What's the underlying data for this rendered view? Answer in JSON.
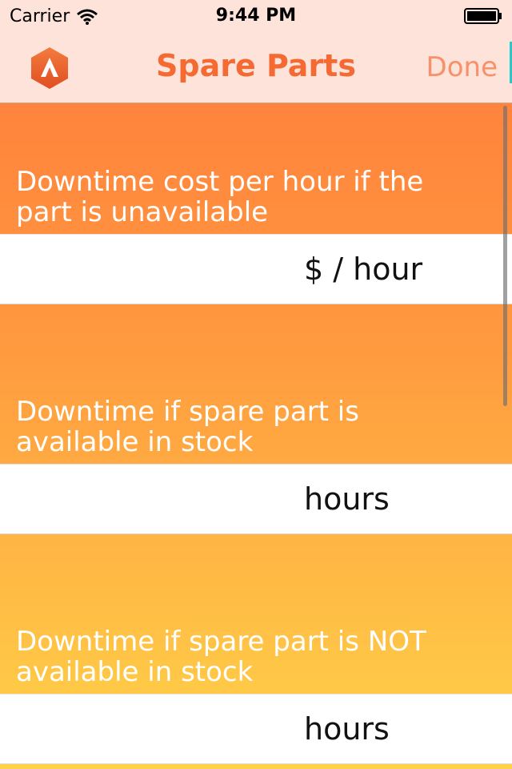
{
  "status": {
    "carrier": "Carrier",
    "time": "9:44 PM"
  },
  "nav": {
    "title": "Spare Parts",
    "done": "Done"
  },
  "fields": [
    {
      "label": "Downtime cost per hour if the part is unavailable",
      "unit": "$ / hour",
      "value": ""
    },
    {
      "label": "Downtime if spare part is available in stock",
      "unit": "hours",
      "value": ""
    },
    {
      "label": "Downtime if spare part is NOT available in stock",
      "unit": "hours",
      "value": ""
    }
  ],
  "colors": {
    "title": "#f46a32",
    "done": "#f7916a",
    "nav_bg": "#fde3d9",
    "gradient_top": "#ff7a3c",
    "gradient_bottom": "#ffd24a"
  },
  "icons": [
    "wifi-icon",
    "battery-icon",
    "app-logo-icon"
  ]
}
